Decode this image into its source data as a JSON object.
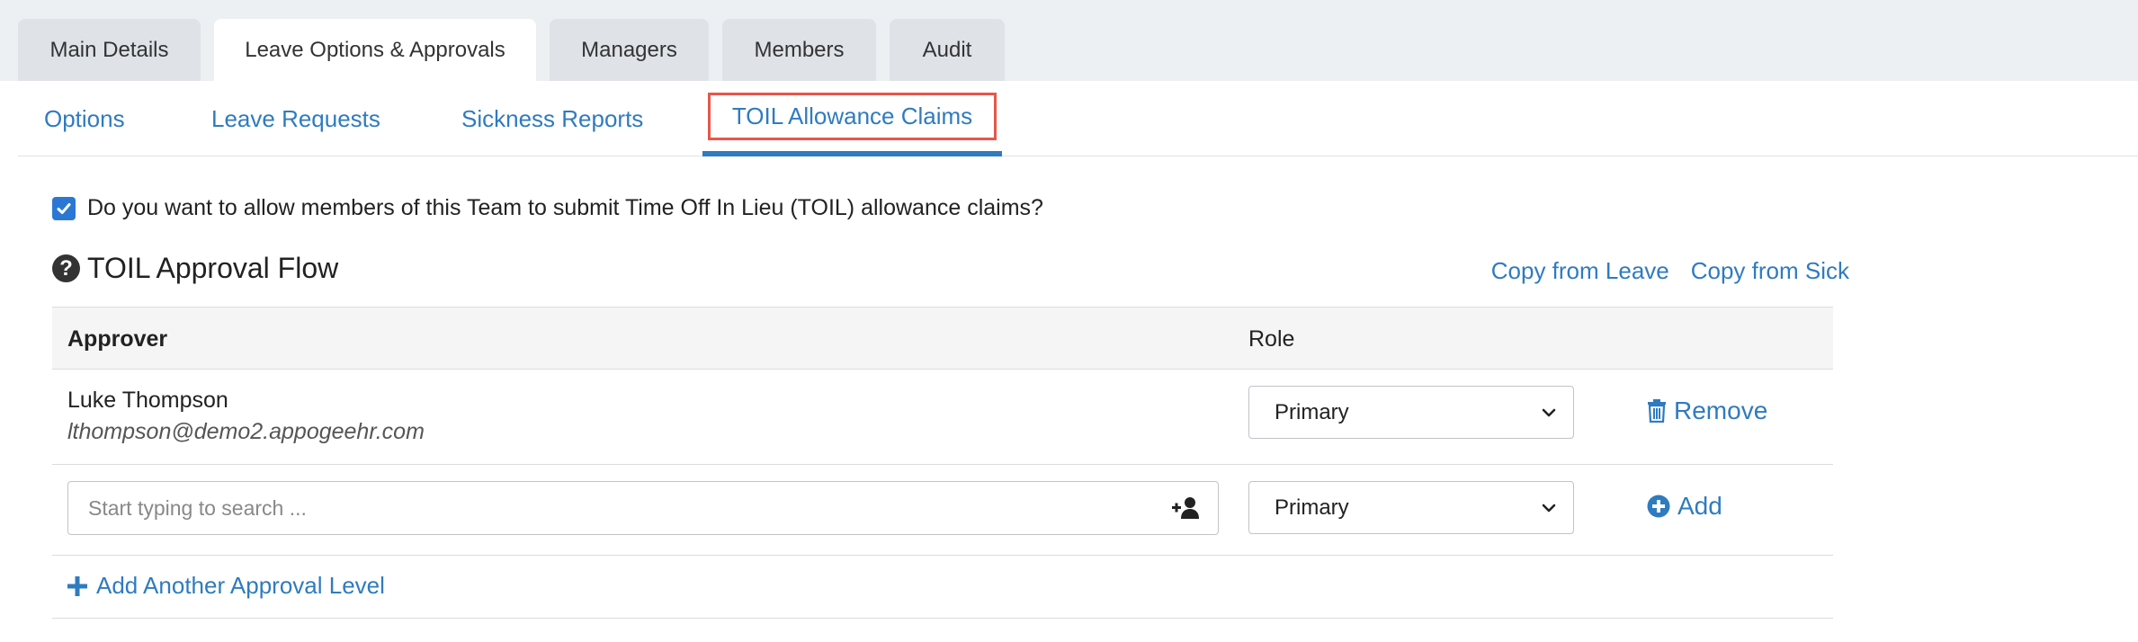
{
  "main_tabs": [
    {
      "label": "Main Details",
      "active": false
    },
    {
      "label": "Leave Options & Approvals",
      "active": true
    },
    {
      "label": "Managers",
      "active": false
    },
    {
      "label": "Members",
      "active": false
    },
    {
      "label": "Audit",
      "active": false
    }
  ],
  "sub_tabs": [
    {
      "label": "Options"
    },
    {
      "label": "Leave Requests"
    },
    {
      "label": "Sickness Reports"
    },
    {
      "label": "TOIL Allowance Claims",
      "active": true
    }
  ],
  "toil": {
    "allow_checkbox_checked": true,
    "allow_checkbox_label": "Do you want to allow members of this Team to submit Time Off In Lieu (TOIL) allowance claims?",
    "flow_title": "TOIL Approval Flow",
    "copy_from_leave": "Copy from Leave",
    "copy_from_sick": "Copy from Sick"
  },
  "table": {
    "headers": {
      "approver": "Approver",
      "role": "Role"
    },
    "rows": [
      {
        "name": "Luke Thompson",
        "email": "lthompson@demo2.appogeehr.com",
        "role": "Primary",
        "action": "Remove"
      }
    ],
    "new_row": {
      "search_placeholder": "Start typing to search ...",
      "role": "Primary",
      "action": "Add"
    },
    "add_level_label": "Add Another Approval Level"
  },
  "colors": {
    "accent": "#2f7bbf",
    "highlight_border": "#e8564a",
    "checkbox": "#2a78d4"
  },
  "icons": {
    "help": "question-circle-icon",
    "trash": "trash-icon",
    "add": "plus-circle-icon",
    "plus": "plus-icon",
    "user_search": "user-add-icon",
    "chevron": "chevron-down-icon"
  }
}
